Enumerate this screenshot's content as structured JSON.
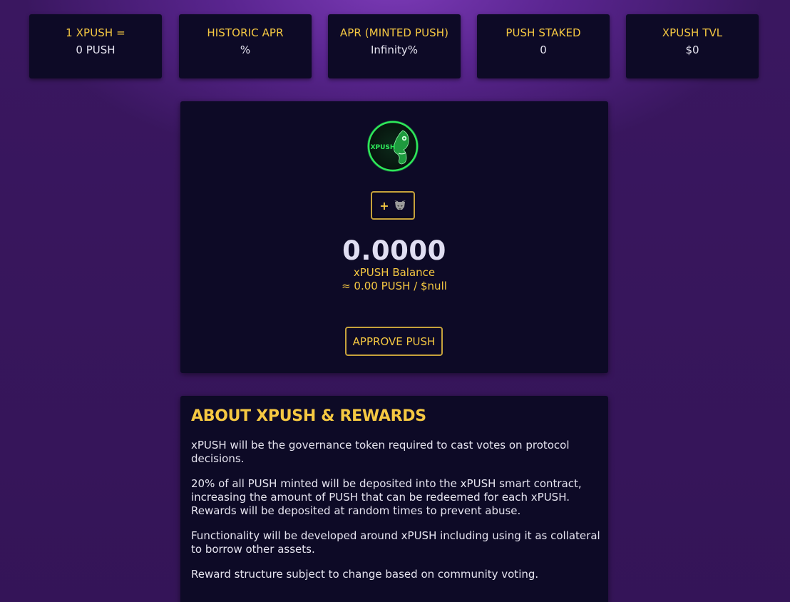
{
  "stats": [
    {
      "label": "1 XPUSH =",
      "value": "0 PUSH"
    },
    {
      "label": "HISTORIC APR",
      "value": "%"
    },
    {
      "label": "APR (MINTED PUSH)",
      "value": "Infinity%"
    },
    {
      "label": "PUSH STAKED",
      "value": "0"
    },
    {
      "label": "XPUSH TVL",
      "value": "$0"
    }
  ],
  "balance_card": {
    "logo_text": "XPUSH",
    "add_token_plus": "+",
    "add_token_icon": "metamask-fox-icon",
    "amount": "0.0000",
    "label": "xPUSH Balance",
    "subvalue": "≈ 0.00 PUSH / $null",
    "approve_label": "APPROVE PUSH"
  },
  "about": {
    "title": "ABOUT XPUSH & REWARDS",
    "paragraphs": [
      "xPUSH will be the governance token required to cast votes on protocol decisions.",
      "20% of all PUSH minted will be deposited into the xPUSH smart contract, increasing the amount of PUSH that can be redeemed for each xPUSH. Rewards will be deposited at random times to prevent abuse.",
      "Functionality will be developed around xPUSH including using it as collateral to borrow other assets.",
      "Reward structure subject to change based on community voting."
    ]
  },
  "colors": {
    "accent": "#f5c842",
    "card_bg": "#0d0a26",
    "page_bg": "#4a1e78",
    "logo_green": "#2ee85a"
  }
}
